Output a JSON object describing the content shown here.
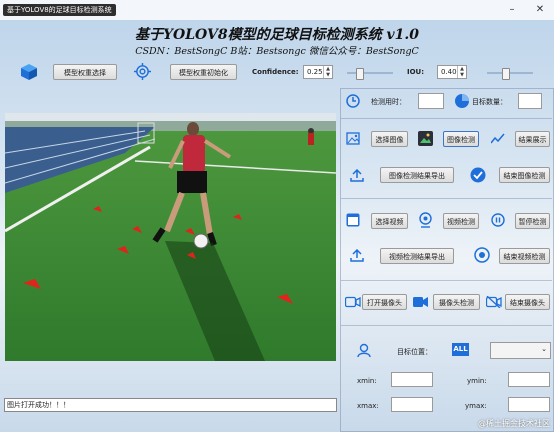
{
  "window": {
    "title": "基于YOLOV8的足球目标检测系统",
    "minimize_icon": "minimize-icon",
    "close_icon": "close-icon"
  },
  "header": {
    "title": "基于YOLOV8模型的足球目标检测系统 v1.0",
    "credits": "CSDN：BestSongC   B站：Bestsongc   微信公众号：BestSongC"
  },
  "toolbar": {
    "model_select_label": "模型权重选择",
    "model_init_label": "模型权重初始化",
    "confidence_label": "Confidence:",
    "confidence_value": "0.25",
    "confidence_level": 0.25,
    "iou_label": "IOU:",
    "iou_value": "0.40",
    "iou_level": 0.4
  },
  "stats": {
    "time_label": "检测用时：",
    "time_value": "",
    "count_label": "目标数量：",
    "count_value": ""
  },
  "image_section": {
    "select_label": "选择图像",
    "detect_label": "图像检测",
    "show_label": "结果展示",
    "export_label": "图像检测结果导出",
    "end_label": "结束图像检测"
  },
  "video_section": {
    "select_label": "选择视频",
    "detect_label": "视频检测",
    "pause_label": "暂停检测",
    "export_label": "视频检测结果导出",
    "end_label": "结束视频检测"
  },
  "camera_section": {
    "open_label": "打开摄像头",
    "detect_label": "摄像头检测",
    "end_label": "结束摄像头"
  },
  "target_section": {
    "position_label": "目标位置：",
    "all_badge": "ALL",
    "selected": "",
    "xmin_label": "xmin:",
    "ymin_label": "ymin:",
    "xmax_label": "xmax:",
    "ymax_label": "ymax:"
  },
  "status_bar": {
    "message": "图片打开成功！！！"
  },
  "watermark": "@稀土掘金技术社区",
  "colors": {
    "accent_blue": "#1e6fd9",
    "grass": "#3f8f3a",
    "cone_red": "#e0241b"
  }
}
